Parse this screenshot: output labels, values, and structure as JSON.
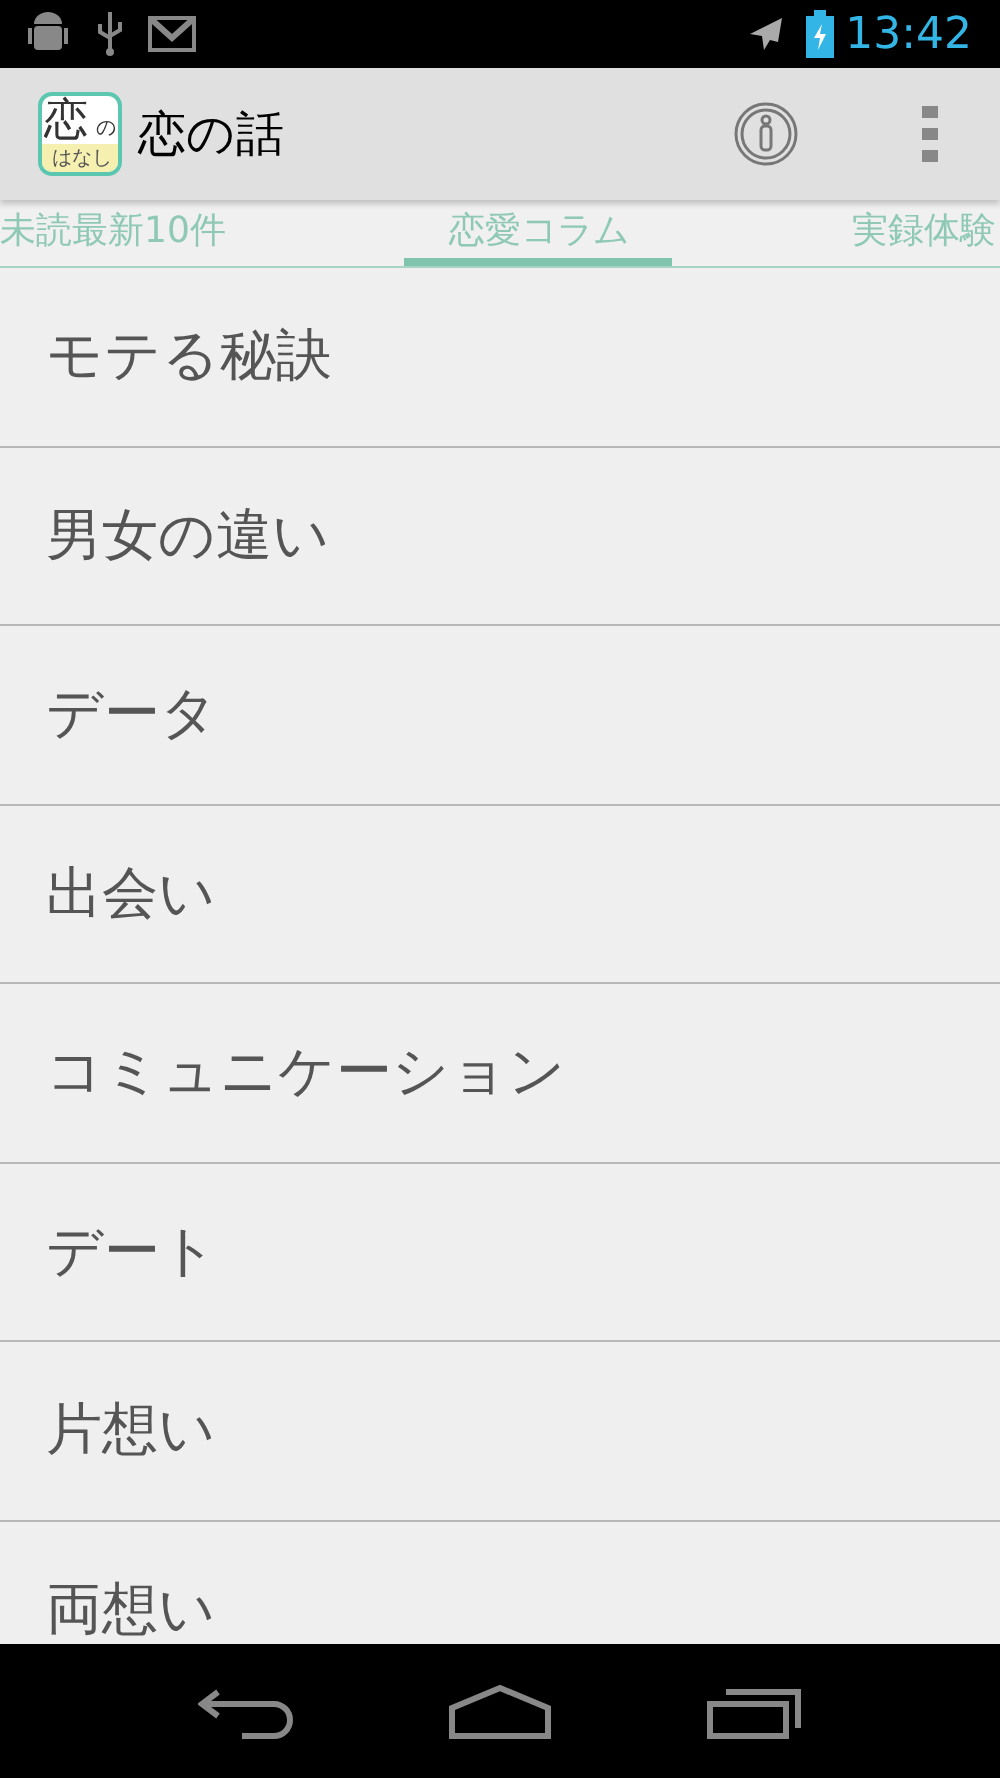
{
  "status_bar": {
    "time": "13:42"
  },
  "action_bar": {
    "app_icon": {
      "main": "恋",
      "small": "の",
      "bottom": "はなし"
    },
    "title": "恋の話"
  },
  "tabs": [
    {
      "label": "未読最新10件",
      "selected": false
    },
    {
      "label": "恋愛コラム",
      "selected": true
    },
    {
      "label": "実録体験",
      "selected": false
    }
  ],
  "items": [
    {
      "label": "モテる秘訣"
    },
    {
      "label": "男女の違い"
    },
    {
      "label": "データ"
    },
    {
      "label": "出会い"
    },
    {
      "label": "コミュニケーション"
    },
    {
      "label": "デート"
    },
    {
      "label": "片想い"
    },
    {
      "label": "両想い"
    }
  ]
}
